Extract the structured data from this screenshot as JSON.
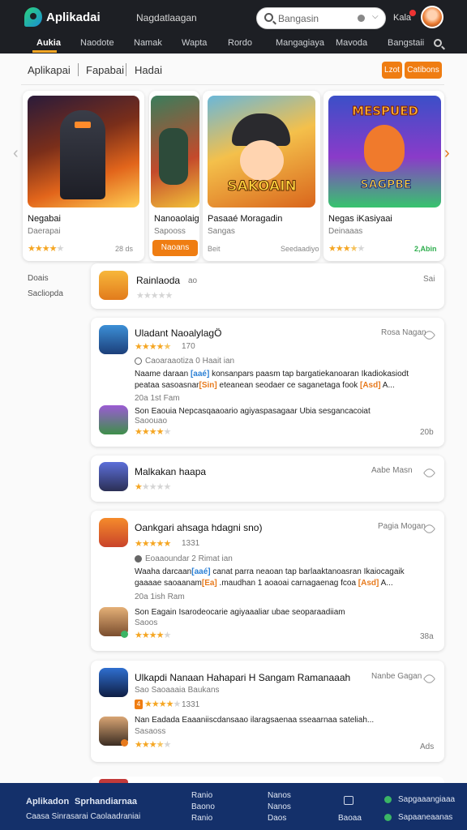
{
  "header": {
    "brand": "Aplikadai",
    "note": "Nagdatlaagan",
    "search_placeholder": "Bangasin",
    "user": "Kala"
  },
  "nav": {
    "items": [
      "Aukia",
      "Naodote",
      "Namak",
      "Wapta",
      "Rordo",
      "Mangagiaya",
      "Mavoda",
      "Bangstaii"
    ],
    "active_index": 0
  },
  "subtabs": {
    "items": [
      "Aplikapai",
      "Fapabai",
      "Hadai"
    ],
    "button1": "Lzot",
    "button2": "Catibons"
  },
  "featured": [
    {
      "name": "Negabai",
      "sub": "Daerapai",
      "rating": 4,
      "size": "28 ds"
    },
    {
      "name": "Nanoaolaig",
      "sub": "Sapooss",
      "rating": 0,
      "size": "",
      "button": "Naoans"
    },
    {
      "name": "Pasaaé Moragadin",
      "sub": "Sangas",
      "rating": 0,
      "size": "Seedaadiyo",
      "extra": "Beit",
      "art_title": "SAKOAIN"
    },
    {
      "name": "Negas iKasiyaai",
      "sub": "Deinaaas",
      "rating": 3.5,
      "size": "2,Abin",
      "art_title1": "MESPUED",
      "art_title2": "SAGPBE"
    }
  ],
  "sidebar": {
    "items": [
      "Doais",
      "Sacliopda"
    ]
  },
  "apps": [
    {
      "title": "Rainlaoda",
      "rating": 0,
      "meta": "ao",
      "right": "Sai"
    },
    {
      "title": "Uladant NaoalylagÖ",
      "rating": 4.5,
      "rcount": "170",
      "meta": "Caoaraaotiza 0 Haait ian",
      "desc1_a": "Naame daraan ",
      "desc1_b": "[aaé]",
      "desc1_c": " konsanpars paasm tap bargatiekanoaran Ikadiokasiodt",
      "desc2_a": "peataa sasoasnar",
      "desc2_b": "[Sin]",
      "desc2_c": " eteanean seodaer ce saganetaga fook ",
      "desc2_d": "[Asd]",
      "desc2_e": " A...",
      "date": "20a 1st Fam",
      "sub_text1": "Son Eaouia  Nepcasqaaoario agiyaspasagaar Ubia sesgancacoiat",
      "sub_text2": "Saoouao",
      "sub_rating": 4,
      "sub_size": "20b",
      "right": "Rosa Nagan"
    },
    {
      "title": "Malkakan haapa",
      "rating": 1,
      "right": "Aabe Masn"
    },
    {
      "title": "Oankgari ahsaga hdagni sno)",
      "rating": 5,
      "rcount": "1331",
      "meta": "Eoaaoundar 2 Rimat ian",
      "desc1_a": "Waaha darcaan",
      "desc1_b": "[aaé]",
      "desc1_c": " canat parra neaoan tap barlaaktanoasran Ikaiocagaik",
      "desc2_a": "gaaaae saoaanam",
      "desc2_b": "[Ea]",
      "desc2_c": " .maudhan 1 aoaoai carnagaenag fcoa ",
      "desc2_d": "[Asd]",
      "desc2_e": " A...",
      "date": "20a 1ish Ram",
      "sub_text1": "Son Eagain  Isarodeocarie agiyaaaliar ubae seoparaadiiam",
      "sub_text2": "Saoos",
      "sub_rating": 4,
      "sub_size": "38a",
      "right": "Pagia Mogan"
    },
    {
      "title": "Ulkapdi Nanaan Hahapari  H  Sangam Ramanaaah",
      "meta": "Sao Saoaaaia Baukans",
      "rating": 4,
      "rcount": "1331",
      "rating_badge": "4",
      "sub_text1": "Nan Eadada  Eaaaniiscdansaao ilaragsaenaa sseaarnaa sateliah...",
      "sub_text2": "Sasaoss",
      "sub_rating": 3.5,
      "sub_size": "Ads",
      "right": "Nanbe Gagan"
    }
  ],
  "footer": {
    "title1": "Aplikadon",
    "title2": "Sprhandiarnaa",
    "line1": "Caasa Sinrasarai Caolaadraniai",
    "col1": [
      "Ranio",
      "Baono"
    ],
    "col2": [
      "Nanos",
      "Daos"
    ],
    "col3": "Baoaa",
    "right1": "Sapgaaangiaaa",
    "right2": "Sapaaneaanas"
  },
  "colors": {
    "accent": "#ef7d12",
    "topbar": "#1d1f24",
    "footer": "#14306a",
    "star": "#f5a623",
    "link": "#2a7fd4"
  }
}
